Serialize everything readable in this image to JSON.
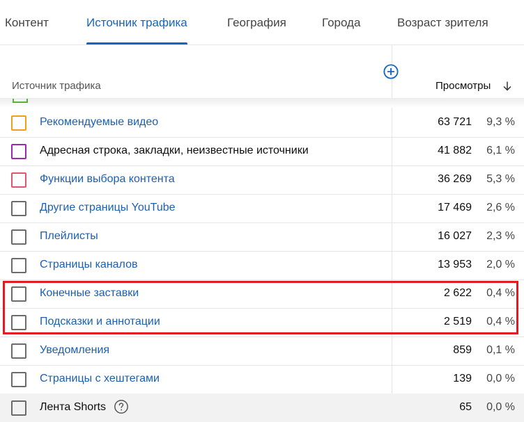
{
  "tabs": [
    {
      "label": "Контент",
      "active": false
    },
    {
      "label": "Источник трафика",
      "active": true
    },
    {
      "label": "География",
      "active": false
    },
    {
      "label": "Города",
      "active": false
    },
    {
      "label": "Возраст зрителя",
      "active": false
    }
  ],
  "table": {
    "header_source": "Источник трафика",
    "header_views": "Просмотры",
    "rows": [
      {
        "label": "Рекомендуемые видео",
        "views": "63 721",
        "pct": "9,3 %",
        "checkbox_color": "#f29d1c",
        "link": true
      },
      {
        "label": "Адресная строка, закладки, неизвестные источники",
        "views": "41 882",
        "pct": "6,1 %",
        "checkbox_color": "#9c27b0",
        "link": false
      },
      {
        "label": "Функции выбора контента",
        "views": "36 269",
        "pct": "5,3 %",
        "checkbox_color": "#e0566e",
        "link": true
      },
      {
        "label": "Другие страницы YouTube",
        "views": "17 469",
        "pct": "2,6 %",
        "checkbox_color": "#6b6b6b",
        "link": true
      },
      {
        "label": "Плейлисты",
        "views": "16 027",
        "pct": "2,3 %",
        "checkbox_color": "#6b6b6b",
        "link": true
      },
      {
        "label": "Страницы каналов",
        "views": "13 953",
        "pct": "2,0 %",
        "checkbox_color": "#6b6b6b",
        "link": true
      },
      {
        "label": "Конечные заставки",
        "views": "2 622",
        "pct": "0,4 %",
        "checkbox_color": "#6b6b6b",
        "link": true
      },
      {
        "label": "Подсказки и аннотации",
        "views": "2 519",
        "pct": "0,4 %",
        "checkbox_color": "#6b6b6b",
        "link": true
      },
      {
        "label": "Уведомления",
        "views": "859",
        "pct": "0,1 %",
        "checkbox_color": "#6b6b6b",
        "link": true
      },
      {
        "label": "Страницы с хештегами",
        "views": "139",
        "pct": "0,0 %",
        "checkbox_color": "#6b6b6b",
        "link": true
      },
      {
        "label": "Лента Shorts",
        "views": "65",
        "pct": "0,0 %",
        "checkbox_color": "#6b6b6b",
        "link": false
      }
    ]
  },
  "colors": {
    "accent": "#1565c0",
    "link": "#1a5fb4",
    "highlight_border": "#e21b23"
  }
}
